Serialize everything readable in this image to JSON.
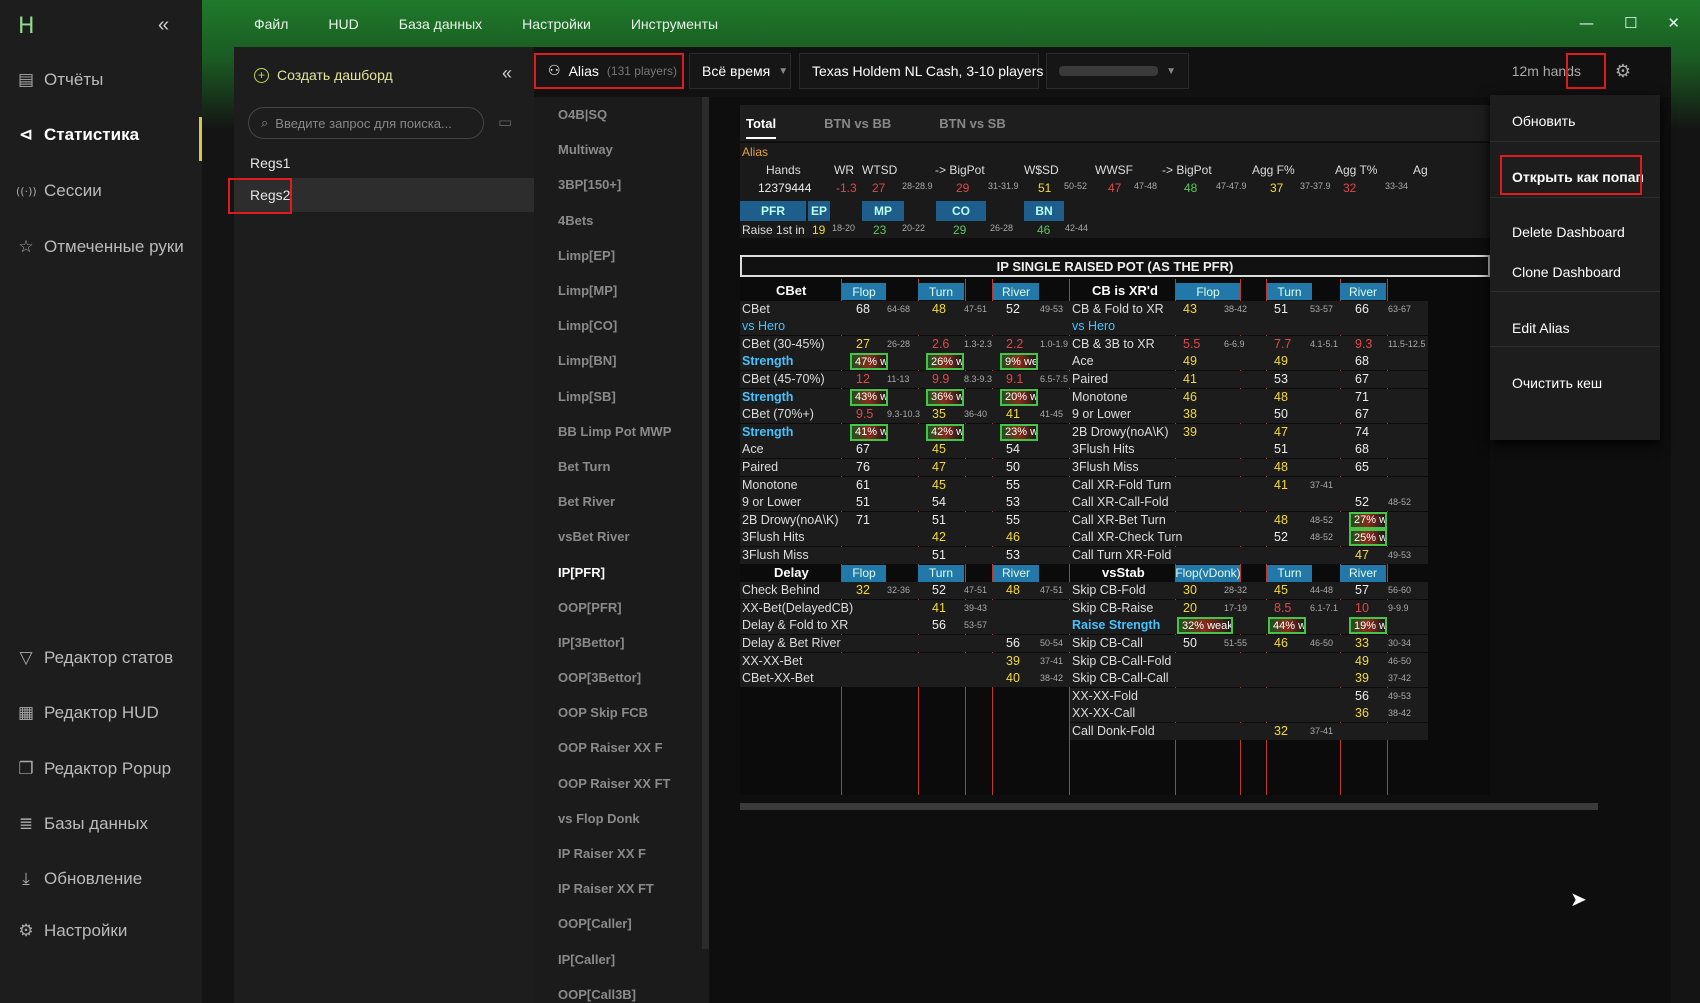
{
  "app": {
    "logo": "H"
  },
  "menu": [
    "Файл",
    "HUD",
    "База данных",
    "Настройки",
    "Инструменты"
  ],
  "nav": {
    "items": [
      {
        "icon": "report-icon",
        "glyph": "▤",
        "label": "Отчёты"
      },
      {
        "icon": "stats-icon",
        "glyph": "⊲",
        "label": "Статистика",
        "active": true
      },
      {
        "icon": "sessions-icon",
        "glyph": "((·))",
        "label": "Сессии"
      },
      {
        "icon": "star-icon",
        "glyph": "☆",
        "label": "Отмеченные руки"
      }
    ],
    "bottom": [
      {
        "icon": "filter-icon",
        "glyph": "▽",
        "label": "Редактор статов"
      },
      {
        "icon": "hud-icon",
        "glyph": "▦",
        "label": "Редактор HUD"
      },
      {
        "icon": "popup-icon",
        "glyph": "❐",
        "label": "Редактор Popup"
      },
      {
        "icon": "database-icon",
        "glyph": "≣",
        "label": "Базы данных"
      },
      {
        "icon": "download-icon",
        "glyph": "⤓",
        "label": "Обновление"
      },
      {
        "icon": "gear-icon",
        "glyph": "⚙",
        "label": "Настройки"
      }
    ]
  },
  "dashpanel": {
    "create_label": "Создать дашборд",
    "search_placeholder": "Введите запрос для поиска...",
    "items": [
      "Regs1",
      "Regs2"
    ]
  },
  "toolbar": {
    "alias_label": "Alias",
    "alias_count": "(131 players)",
    "time": "Всё время",
    "game": "Texas Holdem NL Cash, 3-10 players",
    "player": "",
    "hands": "12m hands"
  },
  "statlist": [
    "O4B|SQ",
    "Multiway",
    "3BP[150+]",
    "4Bets",
    "Limp[EP]",
    "Limp[MP]",
    "Limp[CO]",
    "Limp[BN]",
    "Limp[SB]",
    "BB Limp Pot MWP",
    "Bet Turn",
    "Bet River",
    "vsBet River",
    "IP[PFR]",
    "OOP[PFR]",
    "IP[3Bettor]",
    "OOP[3Bettor]",
    "OOP Skip FCB",
    "OOP Raiser XX F",
    "OOP Raiser XX FT",
    "vs Flop Donk",
    "IP Raiser XX F",
    "IP Raiser XX FT",
    "OOP[Caller]",
    "IP[Caller]",
    "OOP[Call3B]"
  ],
  "tabs": [
    "Total",
    "BTN vs BB",
    "BTN vs SB"
  ],
  "header": {
    "alias": "Alias",
    "cols": [
      "Hands",
      "WR",
      "WTSD",
      "-> BigPot",
      "W$SD",
      "WWSF",
      "-> BigPot",
      "Agg F%",
      "Agg T%",
      "Ag"
    ],
    "vals": [
      "12379444",
      "-1.3",
      "27",
      "28-28.9",
      "29",
      "31-31.9",
      "51",
      "50-52",
      "47",
      "47-48",
      "48",
      "47-47.9",
      "37",
      "37-37.9",
      "32",
      "33-34"
    ],
    "positions": [
      "PFR",
      "EP",
      "MP",
      "CO",
      "BN"
    ],
    "r1_label": "Raise 1st in",
    "r1_vals": [
      "19",
      "18-20",
      "23",
      "20-22",
      "29",
      "26-28",
      "46",
      "42-44"
    ]
  },
  "matrix": {
    "title": "IP SINGLE RAISED POT (AS THE PFR)",
    "streets": [
      "Flop",
      "Turn",
      "River"
    ],
    "cbet_head": "CBet",
    "xr_head": "CB is XR'd",
    "delay_head": "Delay",
    "vsstab_head": "vsStab",
    "vsstab_flop": "Flop(vDonk)",
    "left_rows": [
      [
        "CBet",
        "68",
        "64-68",
        "48",
        "47-51",
        "52",
        "49-53"
      ],
      [
        "vs Hero",
        "",
        "64-68",
        "",
        "47-51",
        "",
        "49-53"
      ],
      [
        "CBet (30-45%)",
        "27",
        "26-28",
        "2.6",
        "1.3-2.3",
        "2.2",
        "1.0-1.9"
      ],
      [
        "Strength",
        "47% w",
        "",
        "26% w",
        "",
        "9% wea",
        ""
      ],
      [
        "CBet (45-70%)",
        "12",
        "11-13",
        "9.9",
        "8.3-9.3",
        "9.1",
        "6.5-7.5"
      ],
      [
        "Strength",
        "43% w",
        "",
        "36% w",
        "",
        "20% we",
        ""
      ],
      [
        "CBet (70%+)",
        "9.5",
        "9.3-10.3",
        "35",
        "36-40",
        "41",
        "41-45"
      ],
      [
        "Strength",
        "41% w",
        "",
        "42% w",
        "",
        "23% we",
        ""
      ],
      [
        "Ace",
        "67",
        "",
        "45",
        "",
        "54",
        ""
      ],
      [
        "Paired",
        "76",
        "",
        "47",
        "",
        "50",
        ""
      ],
      [
        "Monotone",
        "61",
        "",
        "45",
        "",
        "55",
        ""
      ],
      [
        "9 or Lower",
        "51",
        "",
        "54",
        "",
        "53",
        ""
      ],
      [
        "2B Drowy(noA\\K)",
        "71",
        "",
        "51",
        "",
        "55",
        ""
      ],
      [
        "3Flush Hits",
        "",
        "",
        "42",
        "",
        "46",
        ""
      ],
      [
        "3Flush Miss",
        "",
        "",
        "51",
        "",
        "53",
        ""
      ]
    ],
    "right_rows": [
      [
        "CB & Fold to XR",
        "43",
        "38-42",
        "51",
        "53-57",
        "66",
        "63-67"
      ],
      [
        "vs Hero",
        "",
        "38-42",
        "",
        "53-57",
        "",
        "63-67"
      ],
      [
        "CB & 3B to XR",
        "5.5",
        "6-6.9",
        "7.7",
        "4.1-5.1",
        "9.3",
        "11.5-12.5"
      ],
      [
        "Ace",
        "49",
        "",
        "49",
        "",
        "68",
        ""
      ],
      [
        "Paired",
        "41",
        "",
        "53",
        "",
        "67",
        ""
      ],
      [
        "Monotone",
        "46",
        "",
        "48",
        "",
        "71",
        ""
      ],
      [
        "9 or Lower",
        "38",
        "",
        "50",
        "",
        "67",
        ""
      ],
      [
        "2B Drowy(noA\\K)",
        "39",
        "",
        "47",
        "",
        "74",
        ""
      ],
      [
        "3Flush Hits",
        "",
        "",
        "51",
        "",
        "68",
        ""
      ],
      [
        "3Flush Miss",
        "",
        "",
        "48",
        "",
        "65",
        ""
      ],
      [
        "Call XR-Fold Turn",
        "",
        "",
        "41",
        "37-41",
        "",
        ""
      ],
      [
        "Call XR-Call-Fold",
        "",
        "",
        "",
        "",
        "52",
        "48-52"
      ],
      [
        "Call XR-Bet Turn",
        "",
        "",
        "48",
        "48-52",
        "27% we",
        ""
      ],
      [
        "Call XR-Check Turn",
        "",
        "",
        "52",
        "48-52",
        "25% we",
        ""
      ],
      [
        "Call Turn XR-Fold",
        "",
        "",
        "",
        "",
        "47",
        "49-53"
      ]
    ],
    "delay_rows": [
      [
        "Check Behind",
        "32",
        "32-36",
        "52",
        "47-51",
        "48",
        "47-51"
      ],
      [
        "XX-Bet(DelayedCB)",
        "",
        "",
        "41",
        "39-43",
        "",
        ""
      ],
      [
        "Delay & Fold to XR",
        "",
        "",
        "56",
        "53-57",
        "",
        ""
      ],
      [
        "Delay & Bet River",
        "",
        "",
        "",
        "",
        "56",
        "50-54"
      ],
      [
        "XX-XX-Bet",
        "",
        "",
        "",
        "",
        "39",
        "37-41"
      ],
      [
        "CBet-XX-Bet",
        "",
        "",
        "",
        "",
        "40",
        "38-42"
      ]
    ],
    "vsstab_rows": [
      [
        "Skip CB-Fold",
        "30",
        "28-32",
        "45",
        "44-48",
        "57",
        "56-60"
      ],
      [
        "Skip CB-Raise",
        "20",
        "17-19",
        "8.5",
        "6.1-7.1",
        "10",
        "9-9.9"
      ],
      [
        "Raise Strength",
        "32% weak",
        "",
        "44% w",
        "",
        "19% we",
        ""
      ],
      [
        "Skip CB-Call",
        "50",
        "51-55",
        "46",
        "46-50",
        "33",
        "30-34"
      ],
      [
        "Skip CB-Call-Fold",
        "",
        "",
        "",
        "",
        "49",
        "46-50"
      ],
      [
        "Skip CB-Call-Call",
        "",
        "",
        "",
        "",
        "39",
        "37-42"
      ],
      [
        "XX-XX-Fold",
        "",
        "",
        "",
        "",
        "56",
        "49-53"
      ],
      [
        "XX-XX-Call",
        "",
        "",
        "",
        "",
        "36",
        "38-42"
      ],
      [
        "Call Donk-Fold",
        "",
        "",
        "32",
        "37-41",
        "",
        ""
      ]
    ]
  },
  "dropdown": [
    "Обновить",
    "Открыть как попап",
    "Delete Dashboard",
    "Clone Dashboard",
    "Edit Alias",
    "Очистить кеш"
  ],
  "colors": {
    "accent_green": "#1f7a2b",
    "highlight_red": "#e01b1b",
    "yellow": "#f5d93a",
    "position_blue": "#1e5e8c"
  }
}
